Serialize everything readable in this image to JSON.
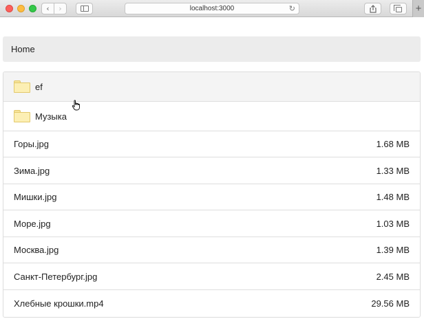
{
  "browser": {
    "url": "localhost:3000",
    "icons": {
      "back": "chevron-left-icon",
      "forward": "chevron-right-icon",
      "sidebar": "sidebar-icon",
      "reload": "reload-icon",
      "share": "share-icon",
      "tabs": "tabs-icon",
      "new_tab": "plus-icon"
    }
  },
  "breadcrumb": {
    "items": [
      "Home"
    ]
  },
  "folders": [
    {
      "name": "ef"
    },
    {
      "name": "Музыка"
    }
  ],
  "files": [
    {
      "name": "Горы.jpg",
      "size": "1.68 MB"
    },
    {
      "name": "Зима.jpg",
      "size": "1.33 MB"
    },
    {
      "name": "Мишки.jpg",
      "size": "1.48 MB"
    },
    {
      "name": "Море.jpg",
      "size": "1.03 MB"
    },
    {
      "name": "Москва.jpg",
      "size": "1.39 MB"
    },
    {
      "name": "Санкт-Петербург.jpg",
      "size": "2.45 MB"
    },
    {
      "name": "Хлебные крошки.mp4",
      "size": "29.56 MB"
    }
  ]
}
